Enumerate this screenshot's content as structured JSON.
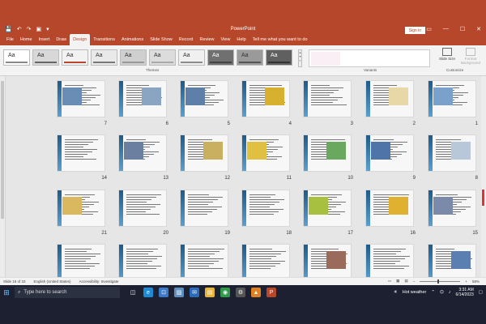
{
  "titlebar": {
    "app_title": "PowerPoint",
    "sign_in": "Sign in",
    "quick_access": [
      "💾",
      "↶",
      "↷",
      "▣",
      "▾"
    ],
    "window_controls": [
      "▭",
      "—",
      "☐",
      "✕"
    ]
  },
  "tabs": [
    "File",
    "Home",
    "Insert",
    "Draw",
    "Design",
    "Transitions",
    "Animations",
    "Slide Show",
    "Record",
    "Review",
    "View",
    "Help"
  ],
  "active_tab": "Design",
  "tell_me": "Tell me what you want to do",
  "ribbon": {
    "themes_label": "Themes",
    "variants_label": "Variants",
    "customize_label": "Customize",
    "theme_glyph": "Aa",
    "slide_size": "Slide Size",
    "format_background": "Format Background",
    "themes": [
      {
        "bg": "#ffffff",
        "accent": "#888888"
      },
      {
        "bg": "#d8d8d8",
        "accent": "#666666"
      },
      {
        "bg": "#f2f2f2",
        "accent": "#b7472a"
      },
      {
        "bg": "#e9e9e9",
        "accent": "#777777"
      },
      {
        "bg": "#cfcfcf",
        "accent": "#999999"
      },
      {
        "bg": "#dcdcdc",
        "accent": "#aaaaaa"
      },
      {
        "bg": "#f0f0f0",
        "accent": "#8a8a8a"
      },
      {
        "bg": "#707070",
        "accent": "#444444"
      },
      {
        "bg": "#9a9a9a",
        "accent": "#555555"
      },
      {
        "bg": "#606060",
        "accent": "#333333"
      }
    ]
  },
  "slides": [
    {
      "num": "7",
      "photo": "#6a8db5"
    },
    {
      "num": "6",
      "photo": "#8aa5c2"
    },
    {
      "num": "5",
      "photo": "#5d7fa8"
    },
    {
      "num": "4",
      "photo": "#d8b030"
    },
    {
      "num": "3",
      "photo": ""
    },
    {
      "num": "2",
      "photo": "#e8d8a8"
    },
    {
      "num": "1",
      "photo": "#7aa0cc"
    },
    {
      "num": "14",
      "photo": ""
    },
    {
      "num": "13",
      "photo": "#6b7fa0"
    },
    {
      "num": "12",
      "photo": "#c9b060"
    },
    {
      "num": "11",
      "photo": "#e0c040"
    },
    {
      "num": "10",
      "photo": "#6aa860"
    },
    {
      "num": "9",
      "photo": "#4f74a8"
    },
    {
      "num": "8",
      "photo": "#b8c8d8"
    },
    {
      "num": "21",
      "photo": "#d9b860"
    },
    {
      "num": "20",
      "photo": ""
    },
    {
      "num": "19",
      "photo": ""
    },
    {
      "num": "18",
      "photo": ""
    },
    {
      "num": "17",
      "photo": "#a8c040"
    },
    {
      "num": "16",
      "photo": "#e0b030"
    },
    {
      "num": "15",
      "photo": "#7a8aa8"
    },
    {
      "num": "",
      "photo": ""
    },
    {
      "num": "",
      "photo": ""
    },
    {
      "num": "",
      "photo": ""
    },
    {
      "num": "",
      "photo": ""
    },
    {
      "num": "",
      "photo": "#9a6a5a"
    },
    {
      "num": "",
      "photo": ""
    },
    {
      "num": "",
      "photo": "#5a7fb0"
    }
  ],
  "statusbar": {
    "slide_info": "Slide 16 of 33",
    "language": "English (United States)",
    "accessibility": "Accessibility: Investigate",
    "zoom": "58%"
  },
  "taskbar": {
    "search_placeholder": "Type here to search",
    "weather": "Hot weather",
    "time": "3:31 AM",
    "date": "6/14/2023",
    "colors": {
      "bg": "#1c2030",
      "accent": "#b7472a"
    }
  }
}
